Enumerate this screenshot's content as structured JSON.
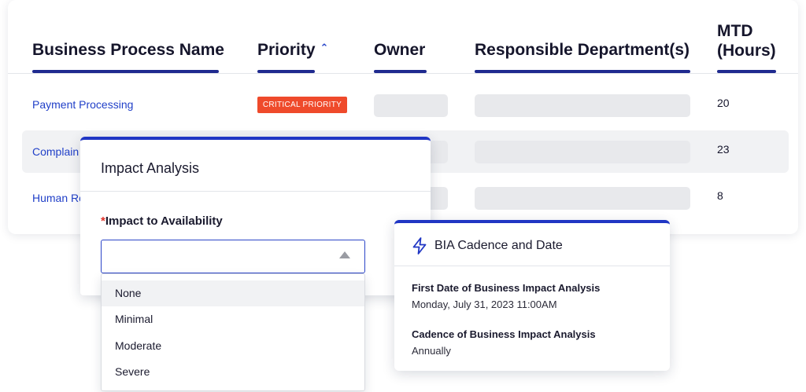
{
  "table": {
    "headers": {
      "name": "Business Process Name",
      "priority": "Priority",
      "owner": "Owner",
      "department": "Responsible Department(s)",
      "mtd_line1": "MTD",
      "mtd_line2": "(Hours)"
    },
    "priority_sort_icon": "chevron-up-icon",
    "rows": [
      {
        "name": "Payment Processing",
        "priority": "CRITICAL PRIORITY",
        "mtd": "20"
      },
      {
        "name": "Complain",
        "mtd": "23"
      },
      {
        "name": "Human Re",
        "mtd": "8"
      }
    ]
  },
  "impact_modal": {
    "title": "Impact Analysis",
    "required_mark": "*",
    "field_label": "Impact to Availability",
    "select_value": "",
    "options": [
      "None",
      "Minimal",
      "Moderate",
      "Severe"
    ]
  },
  "bia_card": {
    "icon": "lightning-bolt-icon",
    "title": "BIA Cadence and Date",
    "first_date_label": "First Date of Business Impact Analysis",
    "first_date_value": "Monday, July 31, 2023 11:00AM",
    "cadence_label": "Cadence of Business Impact Analysis",
    "cadence_value": "Annually"
  },
  "colors": {
    "accent": "#1f2a8f",
    "link": "#2140c8",
    "critical_badge": "#ef4a2b",
    "skeleton": "#e8e9ec"
  }
}
